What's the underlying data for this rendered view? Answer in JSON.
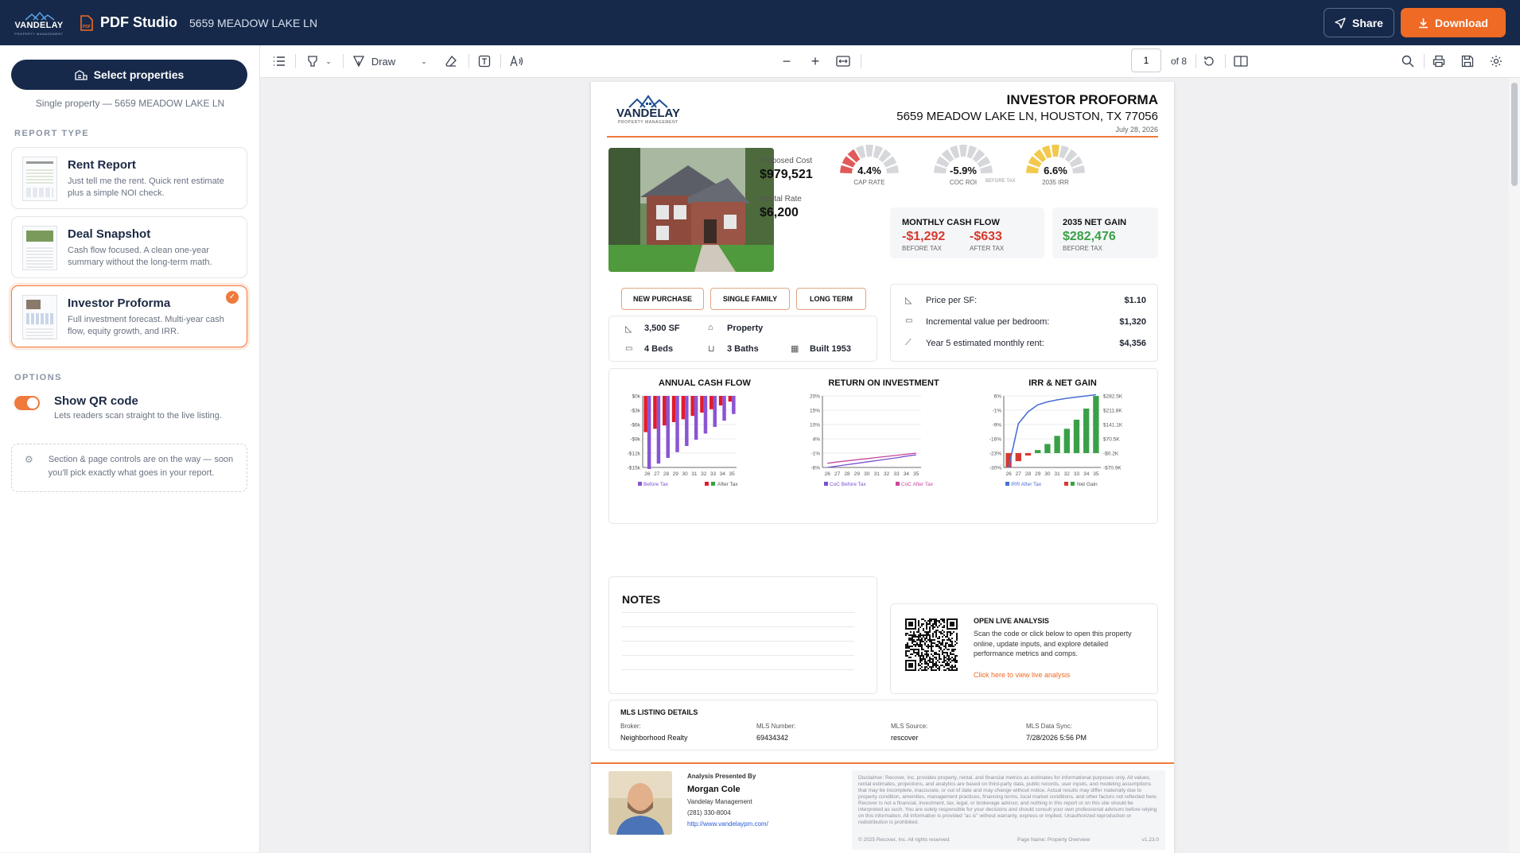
{
  "topbar": {
    "brand": "VANDELAY",
    "brand_tag": "PROPERTY MANAGEMENT",
    "app_name": "PDF Studio",
    "address": "5659 MEADOW LAKE LN",
    "share_label": "Share",
    "download_label": "Download",
    "accent": "#ee6a25",
    "bg": "#16294a"
  },
  "sidebar": {
    "select_label": "Select properties",
    "select_sub": "Single property — 5659 MEADOW LAKE LN",
    "report_type_label": "REPORT TYPE",
    "reports": [
      {
        "title": "Rent Report",
        "desc": "Just tell me the rent. Quick rent estimate plus a simple NOI check.",
        "selected": false
      },
      {
        "title": "Deal Snapshot",
        "desc": "Cash flow focused. A clean one-year summary without the long-term math.",
        "selected": false
      },
      {
        "title": "Investor Proforma",
        "desc": "Full investment forecast. Multi-year cash flow, equity growth, and IRR.",
        "selected": true
      }
    ],
    "options_label": "OPTIONS",
    "qr_title": "Show QR code",
    "qr_sub": "Lets readers scan straight to the live listing.",
    "qr_on": true,
    "coming_note": "Section & page controls are on the way — soon you'll pick exactly what goes in your report."
  },
  "toolbar": {
    "draw_label": "Draw",
    "page_current": "1",
    "page_of": "of 8"
  },
  "doc": {
    "brand": "VANDELAY",
    "brand_tag": "PROPERTY MANAGEMENT",
    "title": "INVESTOR PROFORMA",
    "address": "5659 MEADOW LAKE LN, HOUSTON, TX 77056",
    "date": "July 28, 2026",
    "proposed_cost_label": "Proposed Cost",
    "proposed_cost": "$979,521",
    "rental_rate_label": "Rental Rate",
    "rental_rate": "$6,200",
    "gauges": [
      {
        "value": "4.4%",
        "label": "CAP RATE",
        "fraction": 0.3,
        "color": "#e05a5a"
      },
      {
        "value": "-5.9%",
        "label": "COC ROI",
        "fraction": 0.0,
        "color": "#e05a5a"
      },
      {
        "value": "6.6%",
        "label": "2035 IRR",
        "fraction": 0.5,
        "color": "#f2c94c"
      }
    ],
    "before_tax_mid": "BEFORE TAX",
    "mcf_title": "MONTHLY CASH FLOW",
    "mcf_before": "-$1,292",
    "mcf_before_lbl": "BEFORE TAX",
    "mcf_after": "-$633",
    "mcf_after_lbl": "AFTER TAX",
    "ng_title": "2035 NET GAIN",
    "ng_value": "$282,476",
    "ng_lbl": "BEFORE TAX",
    "pills": [
      "NEW PURCHASE",
      "SINGLE FAMILY",
      "LONG TERM"
    ],
    "facts": {
      "sf": "3,500 SF",
      "type": "Property",
      "beds": "4 Beds",
      "baths": "3 Baths",
      "built": "Built 1953"
    },
    "metrics": [
      {
        "label": "Price per SF:",
        "value": "$1.10"
      },
      {
        "label": "Incremental value per bedroom:",
        "value": "$1,320"
      },
      {
        "label": "Year 5 estimated monthly rent:",
        "value": "$4,356"
      }
    ],
    "notes_title": "NOTES",
    "qr_title": "OPEN LIVE ANALYSIS",
    "qr_text": "Scan the code or click below to open this property online, update inputs, and explore detailed performance metrics and comps.",
    "qr_link": "Click here to view live analysis",
    "mls_title": "MLS LISTING DETAILS",
    "mls": [
      {
        "label": "Broker:",
        "value": "Neighborhood Realty"
      },
      {
        "label": "MLS Number:",
        "value": "69434342"
      },
      {
        "label": "MLS Source:",
        "value": "rescover"
      },
      {
        "label": "MLS Data Sync:",
        "value": "7/28/2026 5:56 PM"
      }
    ],
    "agent_by": "Analysis Presented By",
    "agent_name": "Morgan Cole",
    "agent_company": "Vandelay Management",
    "agent_phone": "(281) 330-8004",
    "agent_url": "http://www.vandelaypm.com/",
    "disclaimer": "Disclaimer: Recover, Inc. provides property, rental, and financial metrics as estimates for informational purposes only. All values, rental estimates, projections, and analytics are based on third-party data, public records, user inputs, and modeling assumptions that may be incomplete, inaccurate, or out of date and may change without notice. Actual results may differ materially due to property condition, amenities, management practices, financing terms, local market conditions, and other factors not reflected here. Recover is not a financial, investment, tax, legal, or brokerage advisor, and nothing in this report or on this site should be interpreted as such. You are solely responsible for your decisions and should consult your own professional advisors before relying on this information. All information is provided \"as is\" without warranty, express or implied. Unauthorized reproduction or redistribution is prohibited.",
    "copyright": "© 2025 Recover, Inc. All rights reserved.",
    "page_name": "Page Name: Property Overview",
    "version": "v1.23.0"
  },
  "chart_data": [
    {
      "type": "bar",
      "title": "ANNUAL CASH FLOW",
      "categories": [
        "26",
        "27",
        "28",
        "29",
        "30",
        "31",
        "32",
        "33",
        "34",
        "35"
      ],
      "yticks": [
        "$0k",
        "-$3k",
        "-$6k",
        "-$9k",
        "-$12k",
        "-$15k"
      ],
      "ylim": [
        -15000,
        0
      ],
      "series": [
        {
          "name": "Before Tax",
          "color": "#8a55d4",
          "values": [
            -15500,
            -14200,
            -13000,
            -11800,
            -10500,
            -9200,
            -7900,
            -6500,
            -5200,
            -3800
          ]
        },
        {
          "name": "After Tax",
          "color": "#e21b2b",
          "values": [
            -7600,
            -6900,
            -6200,
            -5500,
            -4900,
            -4200,
            -3500,
            -2800,
            -2000,
            -1200
          ]
        }
      ],
      "legend_extra_color": "#39a047"
    },
    {
      "type": "line",
      "title": "RETURN ON INVESTMENT",
      "categories": [
        "26",
        "27",
        "28",
        "29",
        "30",
        "31",
        "32",
        "33",
        "34",
        "35"
      ],
      "yticks": [
        "20%",
        "15%",
        "10%",
        "4%",
        "-1%",
        "-6%"
      ],
      "ylim": [
        -6,
        20
      ],
      "series": [
        {
          "name": "CoC Before Tax",
          "color": "#7a4fd0",
          "values": [
            -6,
            -5.5,
            -5,
            -4.5,
            -4,
            -3.5,
            -3,
            -2.5,
            -1.9,
            -1.4
          ]
        },
        {
          "name": "CoC After Tax",
          "color": "#c6479a",
          "values": [
            -4.5,
            -4,
            -3.6,
            -3.2,
            -2.8,
            -2.4,
            -2,
            -1.6,
            -1.2,
            -0.8
          ]
        }
      ]
    },
    {
      "type": "bar",
      "title": "IRR & NET GAIN",
      "categories": [
        "26",
        "27",
        "28",
        "29",
        "30",
        "31",
        "32",
        "33",
        "34",
        "35"
      ],
      "yticks": [
        "6%",
        "-1%",
        "-9%",
        "-16%",
        "-23%",
        "-30%"
      ],
      "yticks_right": [
        "$282.5K",
        "$211.8K",
        "$141.1K",
        "$70.5K",
        "-$0.2K",
        "-$70.9K"
      ],
      "ylim": [
        -70.9,
        282.5
      ],
      "series": [
        {
          "name": "IRR After Tax",
          "color": "#4a6fd4",
          "values": [
            -30,
            -8,
            -2,
            1.5,
            3,
            4,
            4.8,
            5.4,
            6,
            6.6
          ]
        },
        {
          "name": "Net Gain",
          "color": "#39a047",
          "values": [
            -70,
            -40,
            -12,
            15,
            45,
            85,
            120,
            165,
            220,
            282
          ]
        }
      ],
      "legend_extra_color": "#d63a2f"
    }
  ]
}
